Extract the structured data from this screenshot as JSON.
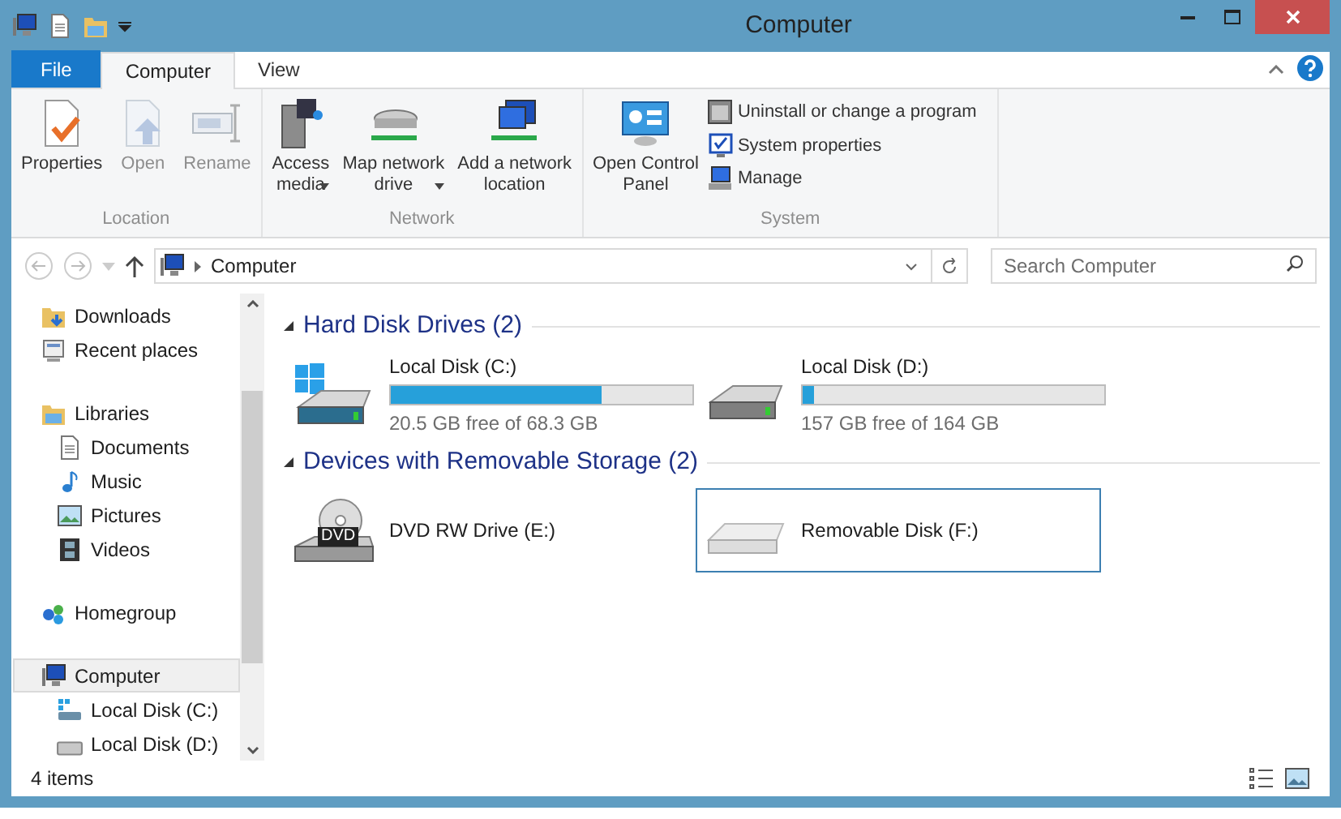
{
  "window": {
    "title": "Computer"
  },
  "ribbon_tabs": [
    {
      "label": "File",
      "kind": "file",
      "selected": false
    },
    {
      "label": "Computer",
      "kind": "tab",
      "selected": true
    },
    {
      "label": "View",
      "kind": "tab",
      "selected": false
    }
  ],
  "ribbon_groups": [
    {
      "label": "Location",
      "items": [
        {
          "label": "Properties",
          "kind": "large",
          "disabled": false,
          "dropdown": false
        },
        {
          "label": "Open",
          "kind": "large",
          "disabled": true,
          "dropdown": false
        },
        {
          "label": "Rename",
          "kind": "large",
          "disabled": true,
          "dropdown": false
        }
      ]
    },
    {
      "label": "Network",
      "items": [
        {
          "label": "Access\nmedia",
          "kind": "large",
          "disabled": false,
          "dropdown": true
        },
        {
          "label": "Map network\ndrive",
          "kind": "large",
          "disabled": false,
          "dropdown": true
        },
        {
          "label": "Add a network\nlocation",
          "kind": "large",
          "disabled": false,
          "dropdown": false
        }
      ]
    },
    {
      "label": "System",
      "items": [
        {
          "label": "Open Control\nPanel",
          "kind": "large",
          "disabled": false,
          "dropdown": false
        },
        {
          "label": "Uninstall or change a program",
          "kind": "small",
          "disabled": false
        },
        {
          "label": "System properties",
          "kind": "small",
          "disabled": false
        },
        {
          "label": "Manage",
          "kind": "small",
          "disabled": false
        }
      ]
    }
  ],
  "address_bar": {
    "path": [
      "Computer"
    ]
  },
  "search": {
    "placeholder": "Search Computer"
  },
  "navigation": [
    [
      {
        "label": "Downloads",
        "kind": "folder",
        "selected": false
      },
      {
        "label": "Recent places",
        "kind": "recent",
        "selected": false
      }
    ],
    [
      {
        "label": "Libraries",
        "kind": "library",
        "selected": false,
        "children": [
          {
            "label": "Documents",
            "kind": "document",
            "selected": false
          },
          {
            "label": "Music",
            "kind": "music",
            "selected": false
          },
          {
            "label": "Pictures",
            "kind": "pictures",
            "selected": false
          },
          {
            "label": "Videos",
            "kind": "videos",
            "selected": false
          }
        ]
      }
    ],
    [
      {
        "label": "Homegroup",
        "kind": "homegroup",
        "selected": false
      }
    ],
    [
      {
        "label": "Computer",
        "kind": "computer",
        "selected": true,
        "children": [
          {
            "label": "Local Disk (C:)",
            "kind": "system_drive",
            "selected": false
          },
          {
            "label": "Local Disk (D:)",
            "kind": "drive",
            "selected": false
          }
        ]
      }
    ]
  ],
  "sections": [
    {
      "title": "Hard Disk Drives (2)",
      "expanded": true,
      "items": [
        {
          "name": "Local Disk (C:)",
          "kind": "system_hdd",
          "level": 0.7,
          "free_space": "20.5 GB free of 68.3 GB",
          "selected": false
        },
        {
          "name": "Local Disk (D:)",
          "kind": "hdd",
          "level": 0.04,
          "free_space": "157 GB free of 164 GB",
          "selected": false
        }
      ]
    },
    {
      "title": "Devices with Removable Storage (2)",
      "expanded": true,
      "items": [
        {
          "name": "DVD RW Drive (E:)",
          "kind": "dvd",
          "dvd_label": "DVD",
          "selected": false
        },
        {
          "name": "Removable Disk (F:)",
          "kind": "usb",
          "selected": true
        }
      ]
    }
  ],
  "status_bar": {
    "text": "4 items"
  }
}
